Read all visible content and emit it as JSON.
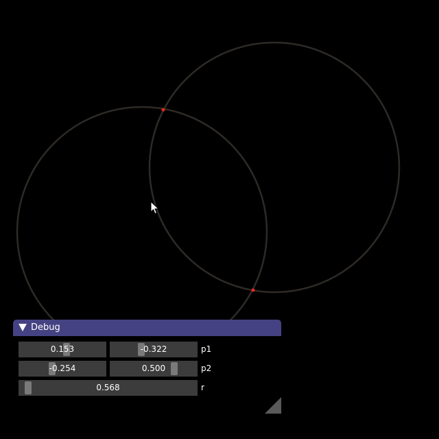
{
  "scene": {
    "circle_color": "#2e2a26",
    "intersection_point_color": "#e02b1c",
    "background_color": "#000000"
  },
  "debug": {
    "title": "Debug",
    "titlebar_color": "#454283",
    "rows": [
      {
        "label": "p1",
        "values": [
          "0.153",
          "-0.322"
        ],
        "levels": [
          0.55,
          0.34
        ]
      },
      {
        "label": "p2",
        "values": [
          "-0.254",
          "0.500"
        ],
        "levels": [
          0.37,
          0.76
        ]
      },
      {
        "label": "r",
        "values": [
          "0.568"
        ],
        "levels": [
          0.03
        ]
      }
    ]
  },
  "icons": {
    "collapse": "triangle-down-icon",
    "cursor": "mouse-pointer-icon",
    "resize": "resize-grip-icon"
  }
}
